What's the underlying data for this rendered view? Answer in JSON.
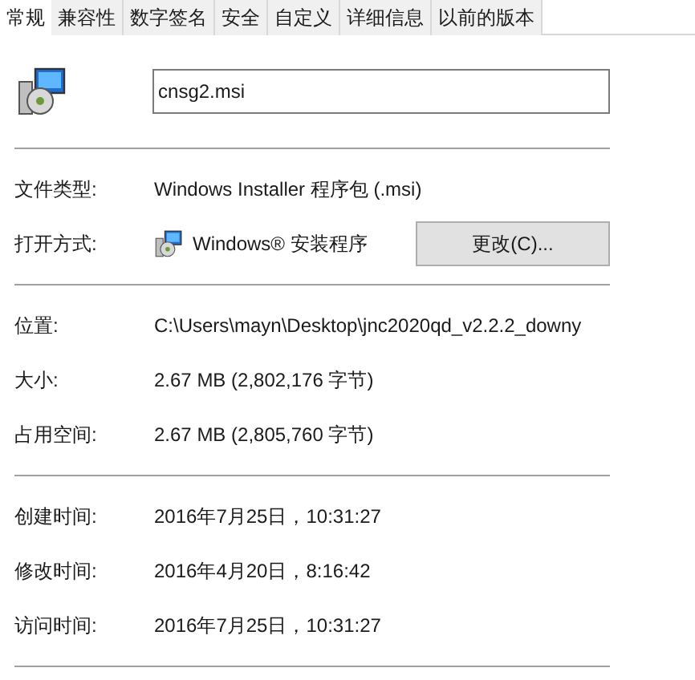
{
  "tabs": [
    {
      "label": "常规",
      "selected": true
    },
    {
      "label": "兼容性",
      "selected": false
    },
    {
      "label": "数字签名",
      "selected": false
    },
    {
      "label": "安全",
      "selected": false
    },
    {
      "label": "自定义",
      "selected": false
    },
    {
      "label": "详细信息",
      "selected": false
    },
    {
      "label": "以前的版本",
      "selected": false
    }
  ],
  "file_name": "cnsg2.msi",
  "groups": [
    [
      {
        "kind": "text",
        "label": "文件类型:",
        "value": "Windows Installer 程序包 (.msi)"
      },
      {
        "kind": "app",
        "label": "打开方式:",
        "value": "Windows® 安装程序",
        "button": "更改(C)..."
      }
    ],
    [
      {
        "kind": "text",
        "label": "位置:",
        "value": "C:\\Users\\mayn\\Desktop\\jnc2020qd_v2.2.2_downy"
      },
      {
        "kind": "text",
        "label": "大小:",
        "value": "2.67 MB (2,802,176 字节)"
      },
      {
        "kind": "text",
        "label": "占用空间:",
        "value": "2.67 MB (2,805,760 字节)"
      }
    ],
    [
      {
        "kind": "text",
        "label": "创建时间:",
        "value": "2016年7月25日，10:31:27"
      },
      {
        "kind": "text",
        "label": "修改时间:",
        "value": "2016年4月20日，8:16:42"
      },
      {
        "kind": "text",
        "label": "访问时间:",
        "value": "2016年7月25日，10:31:27"
      }
    ]
  ]
}
